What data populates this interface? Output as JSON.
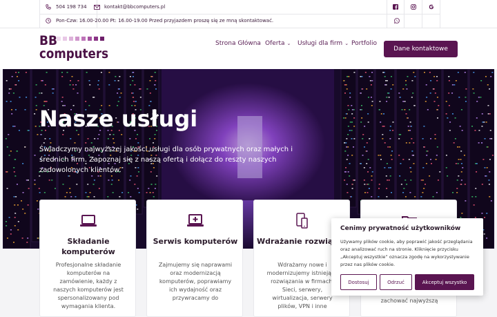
{
  "topbar": {
    "phone": "504 198 734",
    "email": "kontakt@bbcomputers.pl",
    "hours": "Pon-Czw: 16.00-20.00 Pt: 16.00-19.00 Przed przyjazdem proszę się ze mną skontaktować."
  },
  "icons": {
    "phone": "phone-icon",
    "email": "envelope-icon",
    "hours": "clock-icon",
    "facebook": "facebook-icon",
    "instagram": "instagram-icon",
    "google": "google-icon",
    "whatsapp": "whatsapp-icon"
  },
  "brand": {
    "logo_top": "BB",
    "logo_bottom": "computers"
  },
  "nav": {
    "home": "Strona Główna",
    "offer": "Oferta",
    "business": "Usługi dla firm",
    "portfolio": "Portfolio",
    "contact_button": "Dane kontaktowe"
  },
  "hero": {
    "title": "Nasze usługi",
    "text": "Świadczymy najwyższej jakości usługi dla osób prywatnych oraz małych i średnich firm. Zapoznaj się z naszą ofertą i dołącz do reszty naszych zadowolonych klientów."
  },
  "cards": [
    {
      "title": "Składanie komputerów",
      "text": "Profesjonalne składanie komputerów na zamówienie, każdy z naszych komputerów jest spersonalizowany pod wymagania klienta.",
      "icon": "laptop-icon"
    },
    {
      "title": "Serwis komputerów",
      "text": "Zajmujemy się naprawami oraz modernizacją komputerów, poprawiamy ich wydajność oraz przywracamy do",
      "icon": "laptop-plus-icon"
    },
    {
      "title": "Wdrażanie rozwiązań",
      "text": "Wdrażamy nowe i modernizujemy istniejące rozwiązania w firmach. Sieci, serwery, wirtualizacja, serwery plików, VPN i inne",
      "icon": "devices-icon"
    },
    {
      "title": "",
      "text": "klientom, aby mogli zachować najwyższą",
      "icon": "folder-icon"
    }
  ],
  "cookie": {
    "title": "Cenimy prywatność użytkowników",
    "text": "Używamy plików cookie, aby poprawić jakość przeglądania oraz analizować ruch na stronie. Kliknięcie przycisku „Akceptuj wszystkie” oznacza zgodę na wykorzystywanie przez nas plików cookie.",
    "customize": "Dostosuj",
    "reject": "Odrzuć",
    "accept": "Akceptuj wszystko"
  },
  "colors": {
    "brand": "#5a1551",
    "accent": "#7a2a72",
    "hero_glow": "#b46cf0"
  }
}
